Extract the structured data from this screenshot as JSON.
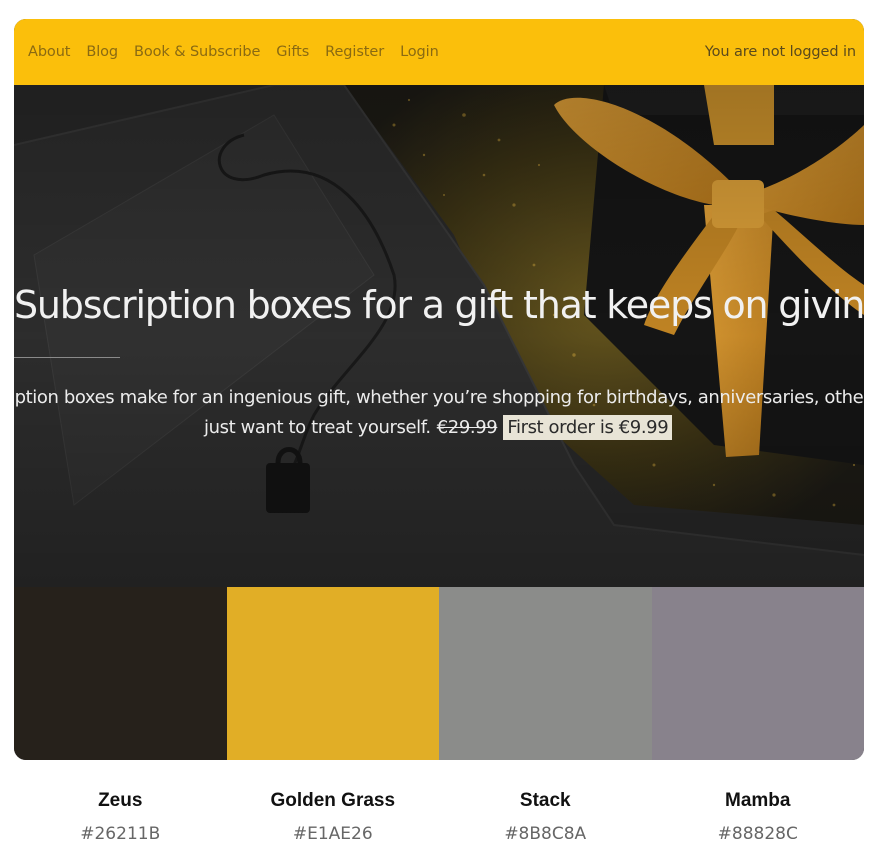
{
  "nav": {
    "links": [
      "About",
      "Blog",
      "Book & Subscribe",
      "Gifts",
      "Register",
      "Login"
    ],
    "status": "You are not logged in"
  },
  "hero": {
    "title": "Subscription boxes for a gift that keeps on giving",
    "subtitle_line1": "iption boxes make for an ingenious gift, whether you’re shopping for birthdays, anniversaries, other",
    "subtitle_line2": "just want to treat yourself.",
    "old_price": "€29.99",
    "promo": "First order is €9.99"
  },
  "palette": [
    {
      "name": "Zeus",
      "hex": "#26211B"
    },
    {
      "name": "Golden Grass",
      "hex": "#E1AE26"
    },
    {
      "name": "Stack",
      "hex": "#8B8C8A"
    },
    {
      "name": "Mamba",
      "hex": "#88828C"
    }
  ],
  "colors": {
    "nav_bg": "#FBBF0B"
  }
}
